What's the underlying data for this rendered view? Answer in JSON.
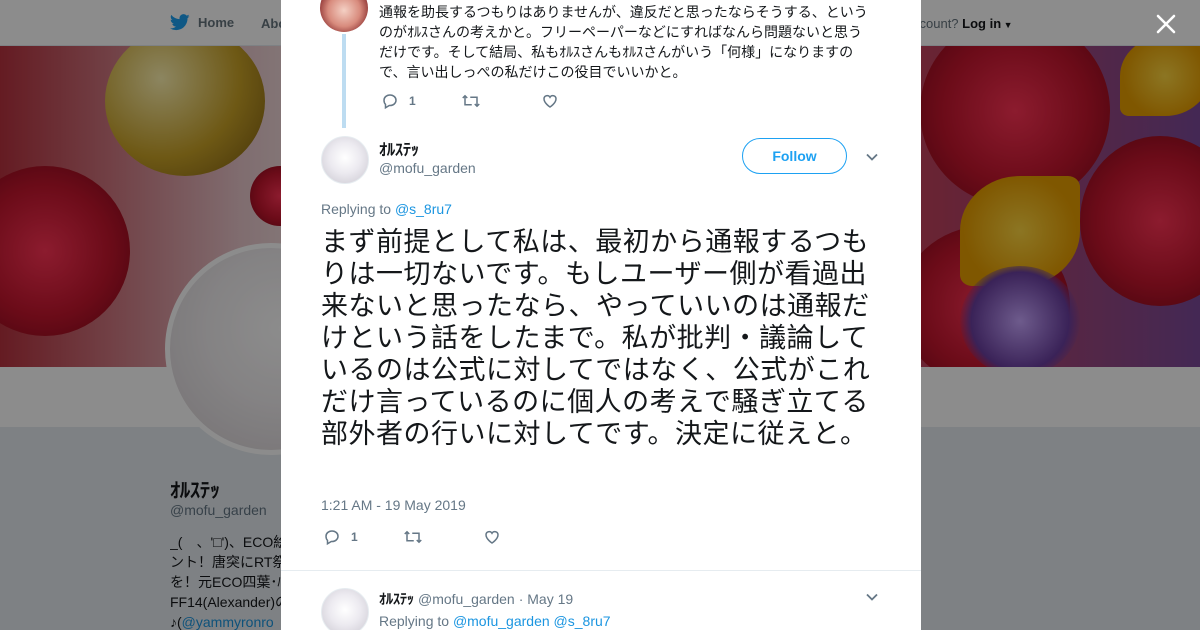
{
  "topbar": {
    "home_label": "Home",
    "about_label": "Abo",
    "account_prompt": "ccount?",
    "login_label": "Log in"
  },
  "profile": {
    "name": "ｵﾙｽﾃｯ",
    "handle": "@mofu_garden",
    "bio_lines": [
      "_(　、'□')、ECO絵",
      "ント！唐突にRT祭",
      "を！元ECO四葉･ﾊ",
      "FF14(Alexander)の",
      "♪("
    ],
    "bio_mention": "@yammyronro"
  },
  "previous_tweet": {
    "text": "通報を助長するつもりはありませんが、違反だと思ったならそうする、というのがｵﾙｽさんの考えかと。フリーペーパーなどにすればなんら問題ないと思うだけです。そして結局、私もｵﾙｽさんもｵﾙｽさんがいう「何様」になりますので、言い出しっぺの私だけこの役目でいいかと。",
    "reply_count": "1"
  },
  "tweet": {
    "author_name": "ｵﾙｽﾃｯ",
    "author_handle": "@mofu_garden",
    "follow_label": "Follow",
    "replying_prefix": "Replying to",
    "replying_to": "@s_8ru7",
    "text": "まず前提として私は、最初から通報するつもりは一切ないです。もしユーザー側が看過出来ないと思ったなら、やっていいのは通報だけという話をしたまで。私が批判・議論しているのは公式に対してではなく、公式がこれだけ言っているのに個人の考えで騒ぎ立てる部外者の行いに対してです。決定に従えと。",
    "timestamp": "1:21 AM - 19 May 2019",
    "reply_count": "1"
  },
  "next_tweet": {
    "author_name": "ｵﾙｽﾃｯ",
    "author_handle": "@mofu_garden",
    "date": "· May 19",
    "replying_prefix": "Replying to",
    "replying_to_1": "@mofu_garden",
    "replying_to_2": "@s_8ru7"
  },
  "colors": {
    "accent": "#1da1f2",
    "link": "#1b95e0",
    "muted": "#657786",
    "thread_line": "#bddcf1"
  },
  "icons": {
    "brand": "twitter-bird-icon",
    "close": "close-icon",
    "reply": "reply-icon",
    "retweet": "retweet-icon",
    "like": "heart-icon",
    "more": "chevron-down-icon"
  }
}
